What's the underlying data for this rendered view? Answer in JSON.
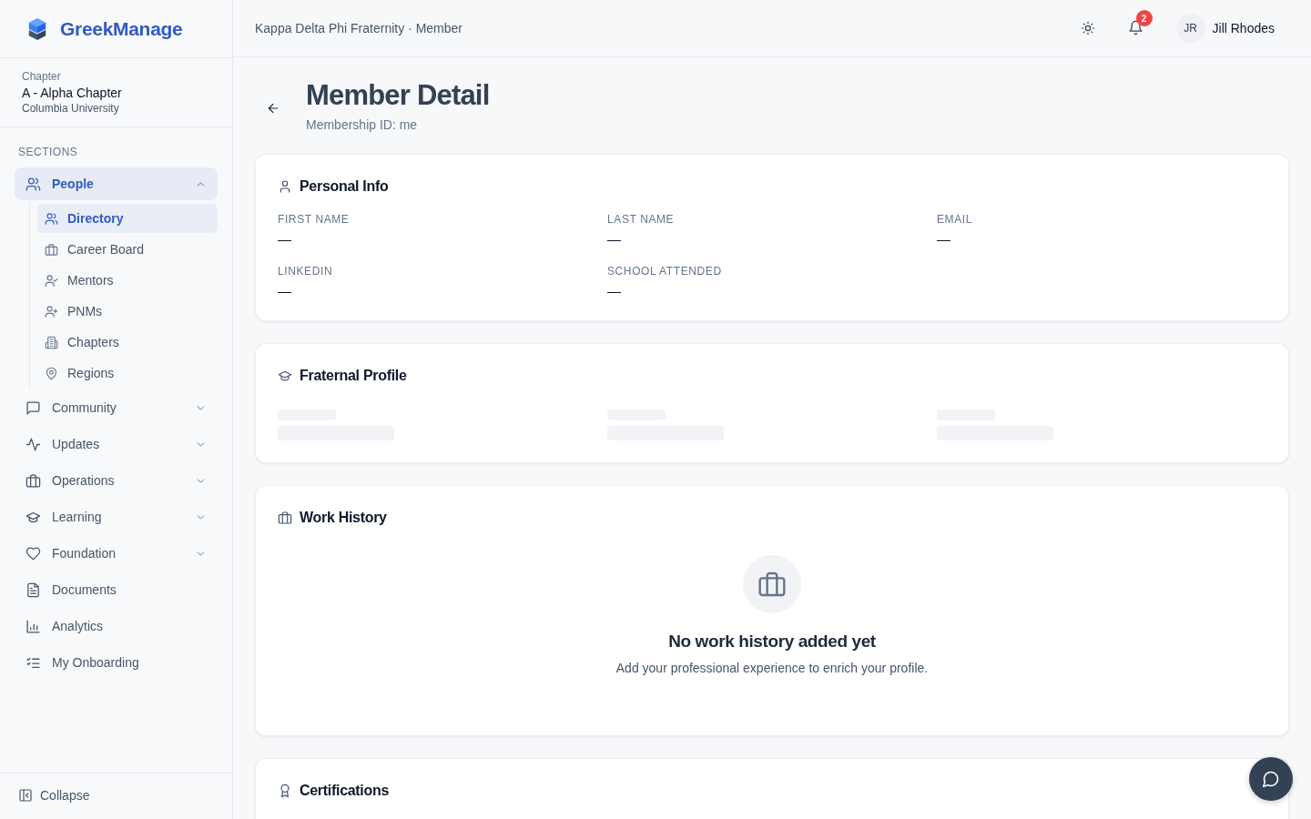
{
  "brand": {
    "name": "GreekManage"
  },
  "chapter": {
    "label": "Chapter",
    "name": "A - Alpha Chapter",
    "school": "Columbia University"
  },
  "sidebar": {
    "heading": "SECTIONS",
    "items": [
      {
        "label": "People",
        "selected": true,
        "expanded": true,
        "children": [
          {
            "label": "Directory",
            "selected": true
          },
          {
            "label": "Career Board",
            "selected": false
          },
          {
            "label": "Mentors",
            "selected": false
          },
          {
            "label": "PNMs",
            "selected": false
          },
          {
            "label": "Chapters",
            "selected": false
          },
          {
            "label": "Regions",
            "selected": false
          }
        ]
      },
      {
        "label": "Community",
        "selected": false,
        "expanded": false
      },
      {
        "label": "Updates",
        "selected": false,
        "expanded": false
      },
      {
        "label": "Operations",
        "selected": false,
        "expanded": false
      },
      {
        "label": "Learning",
        "selected": false,
        "expanded": false
      },
      {
        "label": "Foundation",
        "selected": false,
        "expanded": false
      },
      {
        "label": "Documents",
        "selected": false
      },
      {
        "label": "Analytics",
        "selected": false
      },
      {
        "label": "My Onboarding",
        "selected": false
      }
    ],
    "collapse": "Collapse"
  },
  "header": {
    "breadcrumb": "Kappa Delta Phi Fraternity · Member",
    "notification_count": "2",
    "user": {
      "initials": "JR",
      "name": "Jill Rhodes"
    }
  },
  "page": {
    "title": "Member Detail",
    "subtitle": "Membership ID: me"
  },
  "sections": [
    {
      "kind": "fields",
      "title": "Personal Info",
      "fields": [
        {
          "label": "FIRST NAME",
          "value": "—"
        },
        {
          "label": "LAST NAME",
          "value": "—"
        },
        {
          "label": "EMAIL",
          "value": "—"
        },
        {
          "label": "LINKEDIN",
          "value": "—"
        },
        {
          "label": "SCHOOL ATTENDED",
          "value": "—"
        }
      ]
    },
    {
      "kind": "loading",
      "title": "Fraternal Profile"
    },
    {
      "kind": "empty",
      "title": "Work History",
      "empty_title": "No work history added yet",
      "empty_text": "Add your professional experience to enrich your profile."
    },
    {
      "kind": "heading",
      "title": "Certifications"
    }
  ]
}
